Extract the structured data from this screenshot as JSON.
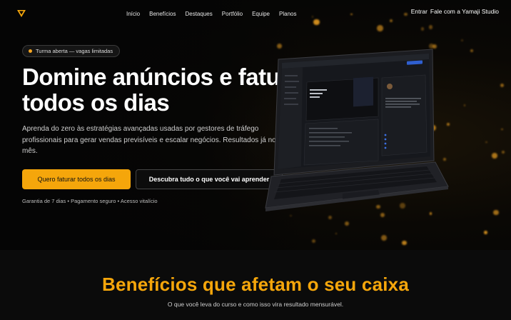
{
  "nav": {
    "items": [
      "Início",
      "Benefícios",
      "Destaques",
      "Portfólio",
      "Equipe",
      "Planos"
    ],
    "login": "Entrar",
    "contact": "Fale com a Yamaji Studio"
  },
  "hero": {
    "badge": "Turma aberta — vagas limitadas",
    "headline_line1": "Domine anúncios e fature",
    "headline_line2": "todos os dias",
    "subtitle": "Aprenda do zero às estratégias avançadas usadas por gestores de tráfego profissionais para gerar vendas previsíveis e escalar negócios. Resultados já no 1º mês.",
    "cta_primary": "Quero faturar todos os dias",
    "cta_secondary": "Descubra tudo o que você vai aprender",
    "guarantee": "Garantia de 7 dias • Pagamento seguro • Acesso vitalício"
  },
  "benefits": {
    "title": "Benefícios que afetam o seu caixa",
    "subtitle": "O que você leva do curso e como isso vira resultado mensurável."
  },
  "colors": {
    "accent": "#f5a60b",
    "background": "#050505"
  }
}
